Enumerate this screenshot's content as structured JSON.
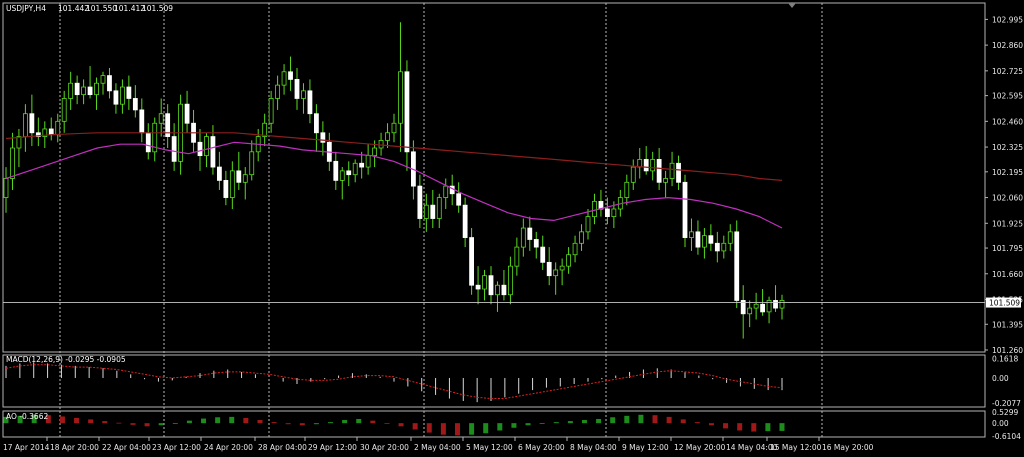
{
  "chart_data": {
    "type": "candlestick",
    "header": {
      "symbol": "USDJPY,H4",
      "open": "101.442",
      "high": "101.550",
      "low": "101.412",
      "close": "101.509"
    },
    "price_axis": {
      "ticks": [
        "102.995",
        "102.860",
        "102.725",
        "102.595",
        "102.460",
        "102.325",
        "102.195",
        "102.060",
        "101.925",
        "101.795",
        "101.660",
        "101.525",
        "101.395",
        "101.260"
      ],
      "range": [
        101.26,
        103.06
      ]
    },
    "current_price": {
      "value": 101.509,
      "label": "101.509"
    },
    "time_axis": {
      "labels": [
        "17 Apr 2014",
        "18 Apr 20:00",
        "22 Apr 04:00",
        "23 Apr 12:00",
        "24 Apr 20:00",
        "28 Apr 04:00",
        "29 Apr 12:00",
        "30 Apr 20:00",
        "2 May 04:00",
        "5 May 12:00",
        "6 May 20:00",
        "8 May 04:00",
        "9 May 12:00",
        "12 May 20:00",
        "14 May 04:00",
        "15 May 12:00",
        "16 May 20:00"
      ]
    },
    "candles": [
      [
        102.06,
        102.22,
        101.98,
        102.16
      ],
      [
        102.16,
        102.4,
        102.1,
        102.32
      ],
      [
        102.32,
        102.42,
        102.22,
        102.38
      ],
      [
        102.38,
        102.55,
        102.3,
        102.5
      ],
      [
        102.5,
        102.6,
        102.33,
        102.4
      ],
      [
        102.4,
        102.48,
        102.33,
        102.38
      ],
      [
        102.38,
        102.46,
        102.32,
        102.42
      ],
      [
        102.42,
        102.48,
        102.36,
        102.39
      ],
      [
        102.39,
        102.5,
        102.35,
        102.46
      ],
      [
        102.46,
        102.62,
        102.4,
        102.58
      ],
      [
        102.58,
        102.72,
        102.52,
        102.66
      ],
      [
        102.66,
        102.7,
        102.55,
        102.6
      ],
      [
        102.6,
        102.68,
        102.55,
        102.64
      ],
      [
        102.64,
        102.75,
        102.58,
        102.6
      ],
      [
        102.6,
        102.69,
        102.52,
        102.66
      ],
      [
        102.66,
        102.72,
        102.6,
        102.7
      ],
      [
        102.7,
        102.74,
        102.58,
        102.62
      ],
      [
        102.62,
        102.66,
        102.5,
        102.55
      ],
      [
        102.55,
        102.68,
        102.5,
        102.64
      ],
      [
        102.64,
        102.7,
        102.52,
        102.58
      ],
      [
        102.58,
        102.65,
        102.48,
        102.52
      ],
      [
        102.52,
        102.58,
        102.35,
        102.4
      ],
      [
        102.4,
        102.45,
        102.26,
        102.3
      ],
      [
        102.3,
        102.48,
        102.25,
        102.45
      ],
      [
        102.45,
        102.58,
        102.38,
        102.5
      ],
      [
        102.5,
        102.55,
        102.32,
        102.38
      ],
      [
        102.38,
        102.45,
        102.2,
        102.25
      ],
      [
        102.25,
        102.6,
        102.18,
        102.55
      ],
      [
        102.55,
        102.62,
        102.4,
        102.45
      ],
      [
        102.45,
        102.52,
        102.3,
        102.35
      ],
      [
        102.35,
        102.42,
        102.2,
        102.28
      ],
      [
        102.28,
        102.4,
        102.22,
        102.38
      ],
      [
        102.38,
        102.44,
        102.18,
        102.22
      ],
      [
        102.22,
        102.3,
        102.1,
        102.15
      ],
      [
        102.15,
        102.2,
        102.02,
        102.06
      ],
      [
        102.06,
        102.25,
        102.0,
        102.2
      ],
      [
        102.2,
        102.3,
        102.1,
        102.14
      ],
      [
        102.14,
        102.22,
        102.05,
        102.18
      ],
      [
        102.18,
        102.36,
        102.15,
        102.3
      ],
      [
        102.3,
        102.42,
        102.25,
        102.38
      ],
      [
        102.38,
        102.5,
        102.33,
        102.45
      ],
      [
        102.45,
        102.62,
        102.4,
        102.58
      ],
      [
        102.58,
        102.7,
        102.52,
        102.65
      ],
      [
        102.65,
        102.76,
        102.6,
        102.72
      ],
      [
        102.72,
        102.8,
        102.62,
        102.68
      ],
      [
        102.68,
        102.74,
        102.52,
        102.58
      ],
      [
        102.58,
        102.66,
        102.5,
        102.62
      ],
      [
        102.62,
        102.68,
        102.45,
        102.5
      ],
      [
        102.5,
        102.55,
        102.3,
        102.4
      ],
      [
        102.4,
        102.46,
        102.28,
        102.35
      ],
      [
        102.35,
        102.4,
        102.2,
        102.25
      ],
      [
        102.25,
        102.3,
        102.1,
        102.15
      ],
      [
        102.15,
        102.22,
        102.05,
        102.2
      ],
      [
        102.2,
        102.25,
        102.12,
        102.18
      ],
      [
        102.18,
        102.26,
        102.14,
        102.24
      ],
      [
        102.24,
        102.3,
        102.16,
        102.22
      ],
      [
        102.22,
        102.34,
        102.18,
        102.28
      ],
      [
        102.28,
        102.36,
        102.22,
        102.32
      ],
      [
        102.32,
        102.4,
        102.28,
        102.36
      ],
      [
        102.36,
        102.45,
        102.32,
        102.4
      ],
      [
        102.4,
        102.5,
        102.35,
        102.45
      ],
      [
        102.45,
        102.98,
        102.3,
        102.72
      ],
      [
        102.72,
        102.78,
        102.2,
        102.3
      ],
      [
        102.3,
        102.36,
        102.05,
        102.12
      ],
      [
        102.12,
        102.18,
        101.9,
        101.95
      ],
      [
        101.95,
        102.08,
        101.88,
        102.02
      ],
      [
        102.02,
        102.1,
        101.9,
        101.95
      ],
      [
        101.95,
        102.08,
        101.9,
        102.06
      ],
      [
        102.06,
        102.16,
        102.0,
        102.12
      ],
      [
        102.12,
        102.18,
        102.02,
        102.08
      ],
      [
        102.08,
        102.14,
        101.98,
        102.02
      ],
      [
        102.02,
        102.06,
        101.8,
        101.85
      ],
      [
        101.85,
        101.9,
        101.55,
        101.6
      ],
      [
        101.6,
        101.7,
        101.5,
        101.58
      ],
      [
        101.58,
        101.68,
        101.52,
        101.65
      ],
      [
        101.65,
        101.7,
        101.5,
        101.55
      ],
      [
        101.55,
        101.62,
        101.46,
        101.6
      ],
      [
        101.6,
        101.68,
        101.52,
        101.55
      ],
      [
        101.55,
        101.75,
        101.5,
        101.7
      ],
      [
        101.7,
        101.85,
        101.65,
        101.8
      ],
      [
        101.8,
        101.95,
        101.75,
        101.9
      ],
      [
        101.9,
        101.96,
        101.78,
        101.84
      ],
      [
        101.84,
        101.88,
        101.74,
        101.8
      ],
      [
        101.8,
        101.86,
        101.68,
        101.72
      ],
      [
        101.72,
        101.8,
        101.6,
        101.65
      ],
      [
        101.65,
        101.72,
        101.55,
        101.68
      ],
      [
        101.68,
        101.74,
        101.6,
        101.7
      ],
      [
        101.7,
        101.8,
        101.66,
        101.76
      ],
      [
        101.76,
        101.86,
        101.72,
        101.82
      ],
      [
        101.82,
        101.92,
        101.78,
        101.88
      ],
      [
        101.88,
        102.0,
        101.84,
        101.96
      ],
      [
        101.96,
        102.08,
        101.92,
        102.04
      ],
      [
        102.04,
        102.1,
        101.96,
        102.0
      ],
      [
        102.0,
        102.06,
        101.92,
        101.96
      ],
      [
        101.96,
        102.04,
        101.9,
        102.0
      ],
      [
        102.0,
        102.1,
        101.96,
        102.06
      ],
      [
        102.06,
        102.18,
        102.02,
        102.14
      ],
      [
        102.14,
        102.26,
        102.1,
        102.22
      ],
      [
        102.22,
        102.32,
        102.16,
        102.26
      ],
      [
        102.26,
        102.33,
        102.18,
        102.2
      ],
      [
        102.2,
        102.3,
        102.15,
        102.26
      ],
      [
        102.26,
        102.32,
        102.1,
        102.14
      ],
      [
        102.14,
        102.2,
        102.06,
        102.16
      ],
      [
        102.16,
        102.3,
        102.12,
        102.24
      ],
      [
        102.24,
        102.28,
        102.1,
        102.14
      ],
      [
        102.14,
        102.18,
        101.8,
        101.85
      ],
      [
        101.85,
        101.95,
        101.78,
        101.88
      ],
      [
        101.88,
        101.94,
        101.76,
        101.8
      ],
      [
        101.8,
        101.9,
        101.74,
        101.86
      ],
      [
        101.86,
        101.92,
        101.78,
        101.82
      ],
      [
        101.82,
        101.88,
        101.72,
        101.78
      ],
      [
        101.78,
        101.86,
        101.74,
        101.82
      ],
      [
        101.82,
        101.92,
        101.78,
        101.88
      ],
      [
        101.88,
        101.94,
        101.48,
        101.52
      ],
      [
        101.52,
        101.6,
        101.32,
        101.45
      ],
      [
        101.45,
        101.52,
        101.38,
        101.48
      ],
      [
        101.48,
        101.56,
        101.42,
        101.5
      ],
      [
        101.5,
        101.58,
        101.44,
        101.46
      ],
      [
        101.46,
        101.54,
        101.4,
        101.52
      ],
      [
        101.52,
        101.6,
        101.46,
        101.48
      ],
      [
        101.48,
        101.55,
        101.42,
        101.52
      ]
    ],
    "moving_averages": [
      {
        "color": "#8b1e1e",
        "values": [
          102.37,
          102.38,
          102.39,
          102.395,
          102.4,
          102.4,
          102.4,
          102.4,
          102.4,
          102.4,
          102.4,
          102.39,
          102.38,
          102.37,
          102.36,
          102.35,
          102.34,
          102.33,
          102.32,
          102.31,
          102.3,
          102.29,
          102.28,
          102.27,
          102.26,
          102.25,
          102.24,
          102.23,
          102.22,
          102.21,
          102.2,
          102.19,
          102.18,
          102.16,
          102.15
        ]
      },
      {
        "color": "#c030c0",
        "values": [
          102.16,
          102.2,
          102.24,
          102.28,
          102.32,
          102.34,
          102.34,
          102.31,
          102.29,
          102.32,
          102.35,
          102.34,
          102.33,
          102.31,
          102.3,
          102.29,
          102.28,
          102.25,
          102.2,
          102.14,
          102.08,
          102.03,
          101.98,
          101.95,
          101.94,
          101.97,
          102.0,
          102.03,
          102.05,
          102.06,
          102.05,
          102.03,
          102.0,
          101.96,
          101.9
        ]
      }
    ],
    "macd": {
      "label": "MACD(12,26,9) -0.0295 -0.0905",
      "ticks": [
        "0.1618",
        "0.00",
        "-0.2077"
      ],
      "range": [
        -0.24,
        0.19
      ],
      "hist": [
        0.1,
        0.12,
        0.13,
        0.12,
        0.11,
        0.1,
        0.09,
        0.08,
        0.06,
        0.03,
        -0.01,
        -0.03,
        -0.02,
        0.01,
        0.04,
        0.06,
        0.07,
        0.05,
        0.03,
        0.0,
        -0.03,
        -0.05,
        -0.03,
        -0.01,
        0.02,
        0.04,
        0.03,
        0.01,
        -0.03,
        -0.07,
        -0.11,
        -0.14,
        -0.17,
        -0.19,
        -0.2,
        -0.19,
        -0.16,
        -0.13,
        -0.1,
        -0.08,
        -0.07,
        -0.05,
        -0.03,
        -0.01,
        0.02,
        0.05,
        0.07,
        0.08,
        0.07,
        0.05,
        0.02,
        -0.01,
        -0.04,
        -0.07,
        -0.09,
        -0.1,
        -0.1
      ],
      "signal": [
        0.08,
        0.1,
        0.11,
        0.11,
        0.1,
        0.09,
        0.09,
        0.08,
        0.07,
        0.05,
        0.03,
        0.01,
        0.0,
        0.01,
        0.02,
        0.04,
        0.05,
        0.05,
        0.04,
        0.03,
        0.01,
        -0.01,
        -0.02,
        -0.02,
        -0.01,
        0.01,
        0.02,
        0.02,
        0.01,
        -0.02,
        -0.05,
        -0.08,
        -0.11,
        -0.14,
        -0.16,
        -0.17,
        -0.17,
        -0.15,
        -0.13,
        -0.11,
        -0.09,
        -0.07,
        -0.05,
        -0.03,
        -0.01,
        0.01,
        0.03,
        0.05,
        0.06,
        0.05,
        0.04,
        0.02,
        -0.01,
        -0.03,
        -0.05,
        -0.07,
        -0.08
      ]
    },
    "ao": {
      "label": "AO -0.3662",
      "ticks": [
        "0.5299",
        "0.00",
        "-0.6104"
      ],
      "range": [
        -0.66,
        0.58
      ],
      "values": [
        0.3,
        0.35,
        0.4,
        0.38,
        0.32,
        0.25,
        0.18,
        0.1,
        0.02,
        -0.08,
        -0.15,
        -0.1,
        0.0,
        0.12,
        0.22,
        0.28,
        0.3,
        0.25,
        0.15,
        0.05,
        -0.05,
        -0.1,
        -0.05,
        0.05,
        0.15,
        0.2,
        0.12,
        0.0,
        -0.15,
        -0.3,
        -0.45,
        -0.55,
        -0.58,
        -0.55,
        -0.48,
        -0.35,
        -0.22,
        -0.1,
        0.0,
        0.05,
        0.1,
        0.15,
        0.2,
        0.28,
        0.35,
        0.4,
        0.38,
        0.3,
        0.18,
        0.05,
        -0.1,
        -0.25,
        -0.35,
        -0.4,
        -0.38,
        -0.37
      ]
    }
  }
}
